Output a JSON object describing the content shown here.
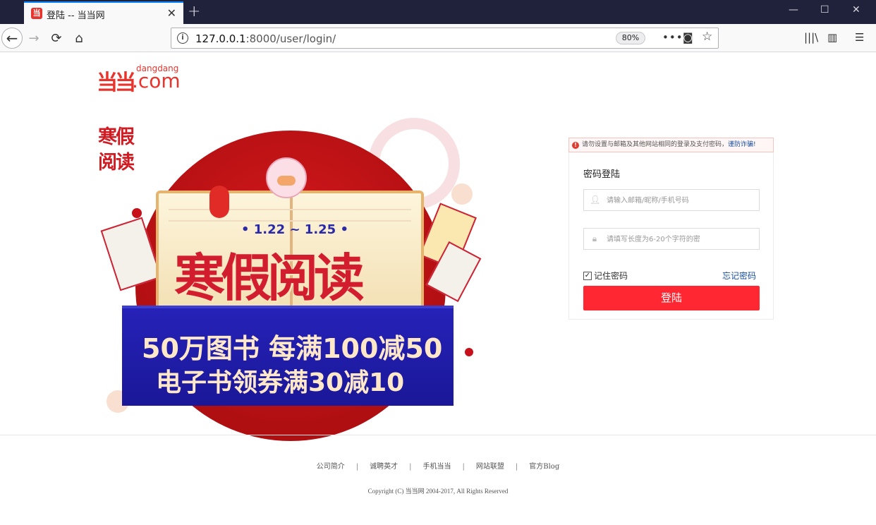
{
  "browser": {
    "tab_title": "登陆 -- 当当网",
    "tab_favicon_glyph": "当",
    "url_host": "127.0.0.1",
    "url_rest": ":8000/user/login/",
    "zoom": "80%"
  },
  "logo": {
    "mark": "当当",
    "small_text": "dangdang",
    "big_text": ".com"
  },
  "banner": {
    "corner_logo_line1": "寒假",
    "corner_logo_line2": "阅读",
    "date": "• 1.22 ~ 1.25 •",
    "headline": "寒假阅读",
    "line1": "50万图书 每满100减50",
    "line2": "电子书领券满30减10"
  },
  "login": {
    "warning_text": "请勿设置与邮箱及其他网站相同的登录及支付密码，",
    "warning_link": "谨防诈骗!",
    "title": "密码登陆",
    "username_placeholder": "请输入邮箱/昵称/手机号码",
    "password_placeholder": "请填写长度为6-20个字符的密",
    "remember_label": "记住密码",
    "remember_checked": true,
    "forgot_label": "忘记密码",
    "submit_label": "登陆"
  },
  "footer": {
    "links": [
      "公司简介",
      "诚聘英才",
      "手机当当",
      "网站联盟",
      "官方Blog"
    ],
    "copyright": "Copyright (C) 当当网 2004-2017, All Rights Reserved"
  },
  "colors": {
    "brand_red": "#e8342c",
    "login_button": "#ff2832",
    "link_blue": "#1a4fa0"
  }
}
